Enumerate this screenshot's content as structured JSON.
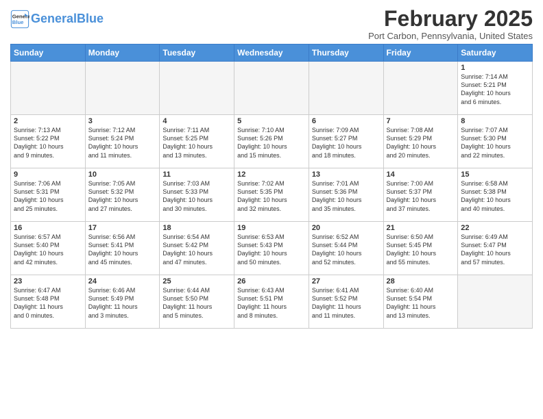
{
  "header": {
    "logo_line1": "General",
    "logo_line2": "Blue",
    "month_title": "February 2025",
    "location": "Port Carbon, Pennsylvania, United States"
  },
  "weekdays": [
    "Sunday",
    "Monday",
    "Tuesday",
    "Wednesday",
    "Thursday",
    "Friday",
    "Saturday"
  ],
  "weeks": [
    [
      {
        "day": "",
        "info": ""
      },
      {
        "day": "",
        "info": ""
      },
      {
        "day": "",
        "info": ""
      },
      {
        "day": "",
        "info": ""
      },
      {
        "day": "",
        "info": ""
      },
      {
        "day": "",
        "info": ""
      },
      {
        "day": "1",
        "info": "Sunrise: 7:14 AM\nSunset: 5:21 PM\nDaylight: 10 hours\nand 6 minutes."
      }
    ],
    [
      {
        "day": "2",
        "info": "Sunrise: 7:13 AM\nSunset: 5:22 PM\nDaylight: 10 hours\nand 9 minutes."
      },
      {
        "day": "3",
        "info": "Sunrise: 7:12 AM\nSunset: 5:24 PM\nDaylight: 10 hours\nand 11 minutes."
      },
      {
        "day": "4",
        "info": "Sunrise: 7:11 AM\nSunset: 5:25 PM\nDaylight: 10 hours\nand 13 minutes."
      },
      {
        "day": "5",
        "info": "Sunrise: 7:10 AM\nSunset: 5:26 PM\nDaylight: 10 hours\nand 15 minutes."
      },
      {
        "day": "6",
        "info": "Sunrise: 7:09 AM\nSunset: 5:27 PM\nDaylight: 10 hours\nand 18 minutes."
      },
      {
        "day": "7",
        "info": "Sunrise: 7:08 AM\nSunset: 5:29 PM\nDaylight: 10 hours\nand 20 minutes."
      },
      {
        "day": "8",
        "info": "Sunrise: 7:07 AM\nSunset: 5:30 PM\nDaylight: 10 hours\nand 22 minutes."
      }
    ],
    [
      {
        "day": "9",
        "info": "Sunrise: 7:06 AM\nSunset: 5:31 PM\nDaylight: 10 hours\nand 25 minutes."
      },
      {
        "day": "10",
        "info": "Sunrise: 7:05 AM\nSunset: 5:32 PM\nDaylight: 10 hours\nand 27 minutes."
      },
      {
        "day": "11",
        "info": "Sunrise: 7:03 AM\nSunset: 5:33 PM\nDaylight: 10 hours\nand 30 minutes."
      },
      {
        "day": "12",
        "info": "Sunrise: 7:02 AM\nSunset: 5:35 PM\nDaylight: 10 hours\nand 32 minutes."
      },
      {
        "day": "13",
        "info": "Sunrise: 7:01 AM\nSunset: 5:36 PM\nDaylight: 10 hours\nand 35 minutes."
      },
      {
        "day": "14",
        "info": "Sunrise: 7:00 AM\nSunset: 5:37 PM\nDaylight: 10 hours\nand 37 minutes."
      },
      {
        "day": "15",
        "info": "Sunrise: 6:58 AM\nSunset: 5:38 PM\nDaylight: 10 hours\nand 40 minutes."
      }
    ],
    [
      {
        "day": "16",
        "info": "Sunrise: 6:57 AM\nSunset: 5:40 PM\nDaylight: 10 hours\nand 42 minutes."
      },
      {
        "day": "17",
        "info": "Sunrise: 6:56 AM\nSunset: 5:41 PM\nDaylight: 10 hours\nand 45 minutes."
      },
      {
        "day": "18",
        "info": "Sunrise: 6:54 AM\nSunset: 5:42 PM\nDaylight: 10 hours\nand 47 minutes."
      },
      {
        "day": "19",
        "info": "Sunrise: 6:53 AM\nSunset: 5:43 PM\nDaylight: 10 hours\nand 50 minutes."
      },
      {
        "day": "20",
        "info": "Sunrise: 6:52 AM\nSunset: 5:44 PM\nDaylight: 10 hours\nand 52 minutes."
      },
      {
        "day": "21",
        "info": "Sunrise: 6:50 AM\nSunset: 5:45 PM\nDaylight: 10 hours\nand 55 minutes."
      },
      {
        "day": "22",
        "info": "Sunrise: 6:49 AM\nSunset: 5:47 PM\nDaylight: 10 hours\nand 57 minutes."
      }
    ],
    [
      {
        "day": "23",
        "info": "Sunrise: 6:47 AM\nSunset: 5:48 PM\nDaylight: 11 hours\nand 0 minutes."
      },
      {
        "day": "24",
        "info": "Sunrise: 6:46 AM\nSunset: 5:49 PM\nDaylight: 11 hours\nand 3 minutes."
      },
      {
        "day": "25",
        "info": "Sunrise: 6:44 AM\nSunset: 5:50 PM\nDaylight: 11 hours\nand 5 minutes."
      },
      {
        "day": "26",
        "info": "Sunrise: 6:43 AM\nSunset: 5:51 PM\nDaylight: 11 hours\nand 8 minutes."
      },
      {
        "day": "27",
        "info": "Sunrise: 6:41 AM\nSunset: 5:52 PM\nDaylight: 11 hours\nand 11 minutes."
      },
      {
        "day": "28",
        "info": "Sunrise: 6:40 AM\nSunset: 5:54 PM\nDaylight: 11 hours\nand 13 minutes."
      },
      {
        "day": "",
        "info": ""
      }
    ]
  ]
}
